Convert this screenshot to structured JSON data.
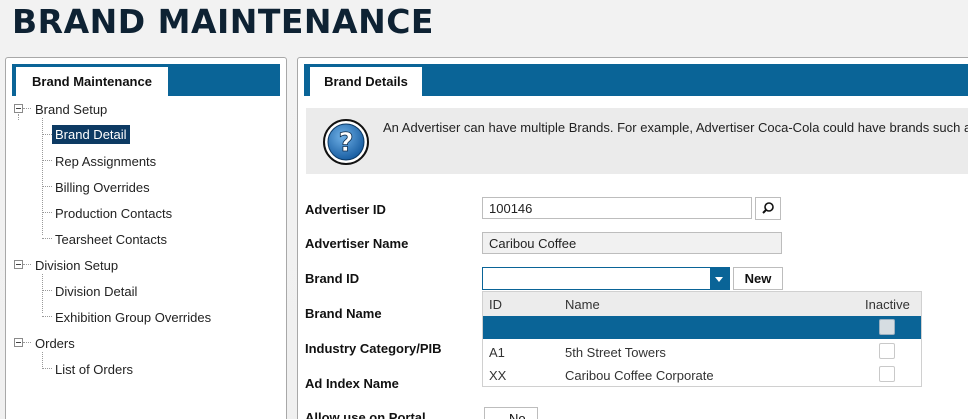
{
  "page": {
    "title": "BRAND MAINTENANCE"
  },
  "left_panel": {
    "tab_label": "Brand Maintenance",
    "tree": [
      {
        "label": "Brand Setup",
        "level": 0,
        "expanded": true
      },
      {
        "label": "Brand Detail",
        "level": 1,
        "selected": true
      },
      {
        "label": "Rep Assignments",
        "level": 1
      },
      {
        "label": "Billing Overrides",
        "level": 1
      },
      {
        "label": "Production Contacts",
        "level": 1
      },
      {
        "label": "Tearsheet Contacts",
        "level": 1
      },
      {
        "label": "Division Setup",
        "level": 0,
        "expanded": true
      },
      {
        "label": "Division Detail",
        "level": 1
      },
      {
        "label": "Exhibition Group Overrides",
        "level": 1
      },
      {
        "label": "Orders",
        "level": 0,
        "expanded": true
      },
      {
        "label": "List of Orders",
        "level": 1
      }
    ]
  },
  "right_panel": {
    "tab_label": "Brand Details",
    "info_text": "An Advertiser can have multiple Brands. For example, Advertiser Coca-Cola could have brands such as",
    "form": {
      "advertiser_id_label": "Advertiser ID",
      "advertiser_id_value": "100146",
      "advertiser_name_label": "Advertiser Name",
      "advertiser_name_value": "Caribou Coffee",
      "brand_id_label": "Brand ID",
      "brand_id_value": "",
      "new_button": "New",
      "brand_name_label": "Brand Name",
      "industry_category_label": "Industry Category/PIB",
      "ad_index_label": "Ad Index Name",
      "allow_portal_label": "Allow use on Portal",
      "allow_portal_value": "No"
    },
    "dropdown": {
      "headers": {
        "id": "ID",
        "name": "Name",
        "inactive": "Inactive"
      },
      "rows": [
        {
          "id": "",
          "name": "",
          "inactive": false,
          "selected": true
        },
        {
          "id": "A1",
          "name": "5th Street Towers",
          "inactive": false
        },
        {
          "id": "XX",
          "name": "Caribou Coffee Corporate",
          "inactive": false
        }
      ]
    }
  },
  "colors": {
    "accent": "#0a6497",
    "selected_tree": "#0d3a63",
    "title": "#0e2233"
  },
  "icons": [
    "help-icon",
    "search-icon",
    "dropdown-arrow-icon",
    "tree-expander-icon"
  ]
}
